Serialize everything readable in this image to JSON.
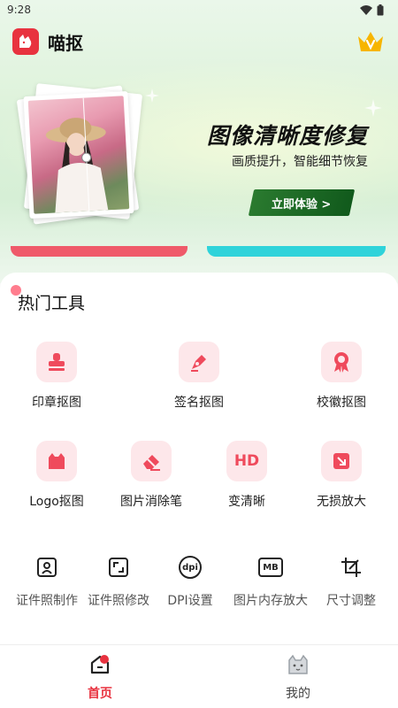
{
  "status": {
    "time": "9:28"
  },
  "app": {
    "name": "喵抠"
  },
  "banner": {
    "title": "图像清晰度修复",
    "subtitle": "画质提升，智能细节恢复",
    "cta": "立即体验 >"
  },
  "hot_tools": {
    "title": "热门工具",
    "row1": [
      {
        "label": "印章抠图",
        "icon": "stamp-icon"
      },
      {
        "label": "签名抠图",
        "icon": "signature-pen-icon"
      },
      {
        "label": "校徽抠图",
        "icon": "badge-icon"
      }
    ],
    "row2": [
      {
        "label": "Logo抠图",
        "icon": "logo-cutout-icon"
      },
      {
        "label": "图片消除笔",
        "icon": "eraser-icon"
      },
      {
        "label": "变清晰",
        "icon": "hd-icon",
        "icon_text": "HD"
      },
      {
        "label": "无损放大",
        "icon": "enlarge-icon"
      }
    ],
    "row3": [
      {
        "label": "证件照制作",
        "icon": "id-photo-icon"
      },
      {
        "label": "证件照修改",
        "icon": "crop-frame-icon"
      },
      {
        "label": "DPI设置",
        "icon": "dpi-icon",
        "icon_text": "dpi"
      },
      {
        "label": "图片内存放大",
        "icon": "mb-icon",
        "icon_text": "MB"
      },
      {
        "label": "尺寸调整",
        "icon": "crop-icon"
      }
    ]
  },
  "nav": {
    "home": "首页",
    "mine": "我的"
  },
  "colors": {
    "accent": "#e8323f",
    "tool_bg": "#fde7ea",
    "cta_green": "#1d6b26",
    "tab_red": "#ef5a6a",
    "tab_cyan": "#2fd3da"
  }
}
